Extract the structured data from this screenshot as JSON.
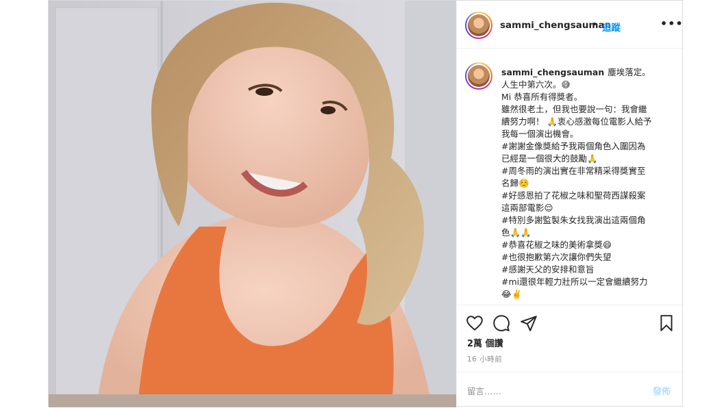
{
  "post": {
    "username": "sammi_chengsauman",
    "dot": "•",
    "follow_label": "追蹤",
    "more_label": "•••",
    "caption_lines": [
      "塵埃落定。",
      "人生中第六次。😅",
      "Mi 恭喜所有得獎者。",
      "雖然很老土，但我也要說一句：我會繼",
      "續努力啊！ 🙏衷心感激每位電影人給予",
      "我每一個演出機會。",
      "#謝謝金像獎給予我兩個角色入圍因為",
      "已經是一個很大的鼓勵🙏",
      "#周冬雨的演出實在非常精采得獎實至",
      "名歸☺️",
      "#好感恩拍了花椒之味和聖荷西謀殺案",
      "這兩部電影😌",
      "#特別多謝監製朱女找我演出這兩個角",
      "色🙏🙏",
      "#恭喜花椒之味的美術拿獎😄",
      "#也很抱歉第六次讓你們失望",
      "#感謝天父的安排和意旨",
      "#mi還很年輕力壯所以一定會繼續努力",
      "😂✌️"
    ],
    "likes": "2萬 個讚",
    "time_ago": "16 小時前",
    "comment_placeholder": "留言……",
    "post_button": "發佈",
    "icons": [
      "heart-icon",
      "comment-icon",
      "share-icon",
      "bookmark-icon"
    ]
  }
}
